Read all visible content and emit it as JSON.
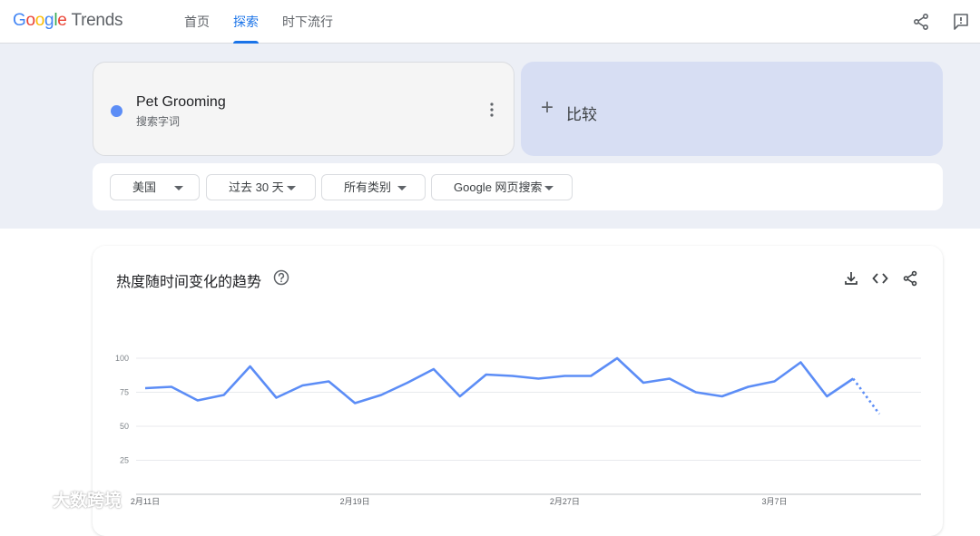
{
  "header": {
    "logo_google": [
      "G",
      "o",
      "o",
      "g",
      "l",
      "e"
    ],
    "logo_trends": "Trends",
    "tabs": [
      {
        "label": "首页",
        "active": false
      },
      {
        "label": "探索",
        "active": true
      },
      {
        "label": "时下流行",
        "active": false
      }
    ],
    "icons": [
      "share-icon",
      "feedback-icon"
    ]
  },
  "term": {
    "title": "Pet Grooming",
    "subtitle": "搜索字词",
    "color": "#5c8df6"
  },
  "compare": {
    "label": "比较"
  },
  "filters": [
    {
      "label": "美国"
    },
    {
      "label": "过去 30 天"
    },
    {
      "label": "所有类别"
    },
    {
      "label": "Google 网页搜索"
    }
  ],
  "chart_section": {
    "title": "热度随时间变化的趋势",
    "actions": [
      "download-icon",
      "embed-icon",
      "share-icon"
    ]
  },
  "chart_data": {
    "type": "line",
    "series": [
      {
        "color": "#5c8df6",
        "values": [
          78,
          79,
          69,
          73,
          94,
          71,
          80,
          83,
          67,
          73,
          82,
          92,
          72,
          88,
          87,
          85,
          87,
          87,
          100,
          82,
          85,
          75,
          72,
          79,
          83,
          97,
          72,
          85
        ],
        "partial_tail": [
          85,
          59
        ]
      }
    ],
    "ylim": [
      0,
      100
    ],
    "yticks": [
      25,
      50,
      75,
      100
    ],
    "xtick_labels": [
      {
        "index": 0,
        "label": "2月11日"
      },
      {
        "index": 8,
        "label": "2月19日"
      },
      {
        "index": 16,
        "label": "2月27日"
      },
      {
        "index": 24,
        "label": "3月7日"
      }
    ],
    "grid": true
  },
  "watermark": {
    "text": "大数跨境"
  }
}
